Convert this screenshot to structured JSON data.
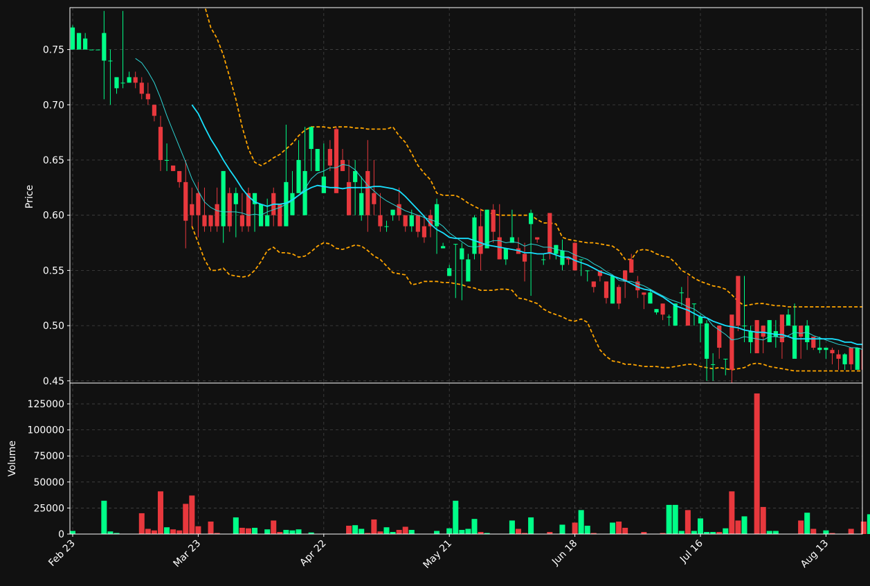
{
  "chart_data": {
    "type": "candlestick",
    "price_axis": {
      "label": "Price",
      "ylim": [
        0.448,
        0.788
      ],
      "ticks": [
        0.45,
        0.5,
        0.55,
        0.6,
        0.65,
        0.7,
        0.75
      ],
      "tick_labels": [
        "0.45",
        "0.50",
        "0.55",
        "0.60",
        "0.65",
        "0.70",
        "0.75"
      ]
    },
    "volume_axis": {
      "label": "Volume",
      "ylim": [
        0,
        145000
      ],
      "ticks": [
        0,
        25000,
        50000,
        75000,
        100000,
        125000
      ],
      "tick_labels": [
        "0",
        "25000",
        "50000",
        "75000",
        "100000",
        "125000"
      ]
    },
    "x_ticks": [
      {
        "label": "Feb 23",
        "index": 0
      },
      {
        "label": "Mar 23",
        "index": 20
      },
      {
        "label": "Apr 22",
        "index": 40
      },
      {
        "label": "May 21",
        "index": 60
      },
      {
        "label": "Jun 18",
        "index": 80
      },
      {
        "label": "Jul 16",
        "index": 100
      },
      {
        "label": "Aug 13",
        "index": 120
      }
    ],
    "grid": true,
    "colors": {
      "up": "#00ff88",
      "down": "#e8383d",
      "ma_fast": "#2dd4d4",
      "ma_slow": "#19e1ff",
      "bands": "#ffa500"
    },
    "candles": {
      "open": [
        0.75,
        0.75,
        0.75,
        0.75,
        0.75,
        0.74,
        0.74,
        0.715,
        0.72,
        0.72,
        0.725,
        0.72,
        0.71,
        0.7,
        0.68,
        0.65,
        0.645,
        0.64,
        0.63,
        0.61,
        0.62,
        0.6,
        0.6,
        0.61,
        0.59,
        0.62,
        0.61,
        0.6,
        0.62,
        0.61,
        0.59,
        0.59,
        0.62,
        0.61,
        0.59,
        0.6,
        0.62,
        0.6,
        0.66,
        0.64,
        0.62,
        0.66,
        0.678,
        0.65,
        0.63,
        0.63,
        0.6,
        0.64,
        0.62,
        0.6,
        0.59,
        0.6,
        0.61,
        0.6,
        0.59,
        0.6,
        0.59,
        0.6,
        0.59,
        0.57,
        0.545,
        0.574,
        0.56,
        0.54,
        0.565,
        0.59,
        0.57,
        0.605,
        0.58,
        0.56,
        0.575,
        0.57,
        0.565,
        0.592,
        0.58,
        0.56,
        0.602,
        0.565,
        0.555,
        0.562,
        0.575,
        0.56,
        0.55,
        0.54,
        0.55,
        0.54,
        0.52,
        0.535,
        0.55,
        0.56,
        0.54,
        0.53,
        0.52,
        0.512,
        0.52,
        0.508,
        0.5,
        0.53,
        0.525,
        0.52,
        0.502,
        0.47,
        0.465,
        0.5,
        0.47,
        0.51,
        0.545,
        0.5,
        0.485,
        0.505,
        0.5,
        0.485,
        0.49,
        0.51,
        0.5,
        0.47,
        0.5,
        0.485,
        0.49,
        0.478,
        0.478,
        0.478,
        0.474,
        0.465,
        0.48,
        0.46,
        0.478,
        0.478,
        0.488,
        0.462
      ],
      "close": [
        0.77,
        0.765,
        0.76,
        0.75,
        0.75,
        0.765,
        0.74,
        0.725,
        0.72,
        0.725,
        0.72,
        0.71,
        0.705,
        0.69,
        0.65,
        0.65,
        0.64,
        0.63,
        0.595,
        0.6,
        0.6,
        0.59,
        0.59,
        0.59,
        0.64,
        0.59,
        0.62,
        0.59,
        0.59,
        0.62,
        0.61,
        0.6,
        0.6,
        0.59,
        0.63,
        0.62,
        0.65,
        0.64,
        0.68,
        0.66,
        0.635,
        0.645,
        0.62,
        0.64,
        0.6,
        0.64,
        0.62,
        0.6,
        0.61,
        0.59,
        0.59,
        0.605,
        0.6,
        0.59,
        0.6,
        0.585,
        0.58,
        0.59,
        0.61,
        0.572,
        0.552,
        0.574,
        0.57,
        0.56,
        0.598,
        0.565,
        0.605,
        0.585,
        0.56,
        0.57,
        0.58,
        0.565,
        0.558,
        0.602,
        0.578,
        0.56,
        0.565,
        0.573,
        0.568,
        0.56,
        0.55,
        0.56,
        0.55,
        0.535,
        0.545,
        0.525,
        0.545,
        0.52,
        0.54,
        0.548,
        0.532,
        0.528,
        0.53,
        0.515,
        0.51,
        0.508,
        0.52,
        0.53,
        0.5,
        0.52,
        0.508,
        0.502,
        0.465,
        0.48,
        0.47,
        0.46,
        0.5,
        0.5,
        0.495,
        0.475,
        0.49,
        0.505,
        0.495,
        0.485,
        0.51,
        0.5,
        0.49,
        0.5,
        0.48,
        0.48,
        0.48,
        0.475,
        0.47,
        0.474,
        0.465,
        0.48,
        0.46,
        0.482,
        0.478,
        0.488,
        0.48
      ],
      "high": [
        0.772,
        0.765,
        0.765,
        0.75,
        0.75,
        0.785,
        0.75,
        0.725,
        0.785,
        0.73,
        0.73,
        0.725,
        0.72,
        0.7,
        0.69,
        0.665,
        0.645,
        0.64,
        0.65,
        0.625,
        0.63,
        0.625,
        0.6,
        0.625,
        0.64,
        0.625,
        0.625,
        0.62,
        0.625,
        0.62,
        0.61,
        0.615,
        0.625,
        0.61,
        0.682,
        0.64,
        0.668,
        0.68,
        0.675,
        0.66,
        0.665,
        0.668,
        0.68,
        0.66,
        0.65,
        0.65,
        0.635,
        0.668,
        0.65,
        0.62,
        0.595,
        0.605,
        0.625,
        0.6,
        0.605,
        0.6,
        0.6,
        0.605,
        0.615,
        0.575,
        0.555,
        0.574,
        0.575,
        0.565,
        0.6,
        0.606,
        0.605,
        0.61,
        0.61,
        0.57,
        0.605,
        0.58,
        0.575,
        0.605,
        0.58,
        0.565,
        0.602,
        0.573,
        0.578,
        0.562,
        0.575,
        0.56,
        0.55,
        0.54,
        0.55,
        0.54,
        0.545,
        0.537,
        0.55,
        0.565,
        0.545,
        0.53,
        0.533,
        0.515,
        0.52,
        0.51,
        0.52,
        0.535,
        0.545,
        0.52,
        0.51,
        0.505,
        0.475,
        0.48,
        0.47,
        0.47,
        0.51,
        0.545,
        0.5,
        0.505,
        0.49,
        0.505,
        0.505,
        0.49,
        0.515,
        0.52,
        0.5,
        0.505,
        0.49,
        0.49,
        0.48,
        0.48,
        0.478,
        0.475,
        0.478,
        0.48,
        0.465,
        0.485,
        0.49,
        0.49,
        0.488
      ],
      "low": [
        0.75,
        0.75,
        0.75,
        0.75,
        0.75,
        0.705,
        0.7,
        0.71,
        0.715,
        0.72,
        0.715,
        0.705,
        0.7,
        0.685,
        0.64,
        0.64,
        0.64,
        0.625,
        0.57,
        0.59,
        0.58,
        0.585,
        0.585,
        0.585,
        0.575,
        0.585,
        0.58,
        0.585,
        0.585,
        0.585,
        0.595,
        0.595,
        0.59,
        0.59,
        0.59,
        0.61,
        0.62,
        0.62,
        0.64,
        0.64,
        0.63,
        0.64,
        0.62,
        0.64,
        0.6,
        0.6,
        0.595,
        0.585,
        0.6,
        0.585,
        0.585,
        0.595,
        0.595,
        0.585,
        0.585,
        0.58,
        0.575,
        0.58,
        0.565,
        0.57,
        0.545,
        0.525,
        0.523,
        0.545,
        0.56,
        0.55,
        0.57,
        0.575,
        0.56,
        0.555,
        0.575,
        0.565,
        0.54,
        0.527,
        0.575,
        0.555,
        0.56,
        0.56,
        0.55,
        0.555,
        0.55,
        0.545,
        0.54,
        0.53,
        0.54,
        0.52,
        0.52,
        0.515,
        0.525,
        0.548,
        0.525,
        0.515,
        0.52,
        0.51,
        0.505,
        0.5,
        0.5,
        0.518,
        0.5,
        0.5,
        0.485,
        0.45,
        0.45,
        0.47,
        0.455,
        0.448,
        0.495,
        0.485,
        0.475,
        0.495,
        0.475,
        0.5,
        0.48,
        0.47,
        0.5,
        0.49,
        0.47,
        0.478,
        0.478,
        0.475,
        0.47,
        0.465,
        0.46,
        0.46,
        0.46,
        0.47,
        0.46,
        0.478,
        0.475,
        0.468,
        0.462
      ]
    },
    "volume": [
      3000,
      0,
      0,
      0,
      0,
      32000,
      2500,
      1000,
      0,
      0,
      0,
      20000,
      5000,
      3500,
      41000,
      6500,
      4500,
      3500,
      29000,
      37000,
      7500,
      0,
      12000,
      1000,
      0,
      0,
      16000,
      6000,
      5500,
      6000,
      0,
      4500,
      13000,
      2000,
      4000,
      3500,
      4500,
      0,
      1500,
      0,
      0,
      0,
      0,
      0,
      8000,
      8500,
      5000,
      1000,
      14000,
      2500,
      6500,
      2000,
      4000,
      7000,
      4000,
      0,
      0,
      0,
      3000,
      0,
      5500,
      32000,
      4000,
      5000,
      14500,
      2000,
      1000,
      0,
      0,
      0,
      13000,
      5000,
      1000,
      16000,
      0,
      0,
      2000,
      0,
      9000,
      0,
      11000,
      23000,
      8000,
      1000,
      0,
      0,
      11000,
      12000,
      6000,
      0,
      0,
      2000,
      0,
      0,
      1000,
      28000,
      28000,
      3000,
      23000,
      3000,
      15000,
      2000,
      2000,
      2000,
      5500,
      41000,
      13000,
      17000,
      0,
      135000,
      26000,
      3000,
      3000,
      0,
      0,
      0,
      13000,
      20500,
      5000,
      0,
      3500,
      1000,
      0,
      0,
      5000,
      0,
      12000,
      19000,
      8000,
      7000,
      6000,
      4000,
      0,
      1000
    ],
    "ma_fast": [
      null,
      null,
      null,
      null,
      null,
      null,
      null,
      null,
      null,
      null,
      0.742,
      0.738,
      0.73,
      0.72,
      0.706,
      0.69,
      0.676,
      0.662,
      0.648,
      0.633,
      0.622,
      0.612,
      0.607,
      0.604,
      0.603,
      0.603,
      0.603,
      0.602,
      0.6,
      0.601,
      0.6,
      0.603,
      0.605,
      0.607,
      0.61,
      0.613,
      0.618,
      0.624,
      0.633,
      0.638,
      0.64,
      0.643,
      0.643,
      0.646,
      0.645,
      0.641,
      0.634,
      0.627,
      0.622,
      0.617,
      0.613,
      0.61,
      0.607,
      0.604,
      0.602,
      0.6,
      0.598,
      0.596,
      0.594,
      0.59,
      0.584,
      0.58,
      0.576,
      0.572,
      0.571,
      0.572,
      0.575,
      0.577,
      0.577,
      0.575,
      0.576,
      0.575,
      0.572,
      0.574,
      0.573,
      0.571,
      0.571,
      0.569,
      0.568,
      0.567,
      0.564,
      0.562,
      0.56,
      0.556,
      0.553,
      0.549,
      0.546,
      0.541,
      0.54,
      0.54,
      0.538,
      0.536,
      0.533,
      0.53,
      0.527,
      0.524,
      0.522,
      0.52,
      0.517,
      0.515,
      0.511,
      0.507,
      0.5,
      0.496,
      0.492,
      0.487,
      0.488,
      0.49,
      0.489,
      0.488,
      0.487,
      0.49,
      0.49,
      0.489,
      0.491,
      0.494,
      0.493,
      0.494,
      0.491,
      0.489,
      0.487,
      0.485,
      0.483,
      0.482,
      0.48,
      0.48,
      0.478,
      0.478,
      0.478,
      0.479,
      0.48
    ],
    "ma_slow": [
      null,
      null,
      null,
      null,
      null,
      null,
      null,
      null,
      null,
      null,
      null,
      null,
      null,
      null,
      null,
      null,
      null,
      null,
      null,
      0.7,
      0.692,
      0.68,
      0.669,
      0.66,
      0.65,
      0.641,
      0.633,
      0.624,
      0.617,
      0.612,
      0.61,
      0.608,
      0.61,
      0.61,
      0.611,
      0.614,
      0.618,
      0.622,
      0.625,
      0.627,
      0.626,
      0.625,
      0.625,
      0.624,
      0.625,
      0.625,
      0.625,
      0.625,
      0.626,
      0.626,
      0.625,
      0.624,
      0.622,
      0.617,
      0.611,
      0.605,
      0.599,
      0.592,
      0.587,
      0.584,
      0.58,
      0.579,
      0.579,
      0.579,
      0.577,
      0.575,
      0.573,
      0.572,
      0.571,
      0.57,
      0.569,
      0.568,
      0.566,
      0.566,
      0.565,
      0.565,
      0.566,
      0.564,
      0.562,
      0.562,
      0.559,
      0.557,
      0.555,
      0.552,
      0.549,
      0.547,
      0.545,
      0.543,
      0.541,
      0.538,
      0.535,
      0.533,
      0.532,
      0.529,
      0.526,
      0.522,
      0.518,
      0.516,
      0.514,
      0.511,
      0.508,
      0.507,
      0.504,
      0.502,
      0.5,
      0.499,
      0.498,
      0.496,
      0.495,
      0.494,
      0.494,
      0.493,
      0.492,
      0.492,
      0.49,
      0.488,
      0.488,
      0.488,
      0.488,
      0.488,
      0.488,
      0.488,
      0.487,
      0.485,
      0.485,
      0.483,
      0.483
    ],
    "band_upper": [
      null,
      null,
      null,
      null,
      null,
      null,
      null,
      null,
      null,
      null,
      null,
      null,
      null,
      null,
      null,
      null,
      null,
      null,
      null,
      0.82,
      0.805,
      0.79,
      0.77,
      0.76,
      0.745,
      0.725,
      0.705,
      0.68,
      0.66,
      0.648,
      0.645,
      0.648,
      0.652,
      0.655,
      0.66,
      0.665,
      0.672,
      0.677,
      0.68,
      0.68,
      0.68,
      0.679,
      0.68,
      0.68,
      0.68,
      0.679,
      0.679,
      0.678,
      0.678,
      0.678,
      0.678,
      0.68,
      0.672,
      0.666,
      0.656,
      0.645,
      0.638,
      0.632,
      0.62,
      0.618,
      0.618,
      0.618,
      0.615,
      0.611,
      0.608,
      0.605,
      0.603,
      0.601,
      0.6,
      0.6,
      0.6,
      0.6,
      0.6,
      0.6,
      0.596,
      0.593,
      0.593,
      0.592,
      0.58,
      0.578,
      0.577,
      0.576,
      0.575,
      0.575,
      0.574,
      0.573,
      0.572,
      0.568,
      0.56,
      0.56,
      0.568,
      0.569,
      0.568,
      0.565,
      0.563,
      0.562,
      0.557,
      0.55,
      0.547,
      0.543,
      0.54,
      0.538,
      0.536,
      0.535,
      0.533,
      0.528,
      0.522,
      0.518,
      0.519,
      0.52,
      0.52,
      0.519,
      0.518,
      0.518,
      0.517,
      0.517,
      0.517,
      0.517,
      0.517,
      0.517,
      0.517,
      0.517,
      0.517,
      0.517,
      0.517,
      0.517,
      0.517
    ],
    "band_lower": [
      null,
      null,
      null,
      null,
      null,
      null,
      null,
      null,
      null,
      null,
      null,
      null,
      null,
      null,
      null,
      null,
      null,
      null,
      null,
      0.59,
      0.575,
      0.56,
      0.55,
      0.55,
      0.552,
      0.546,
      0.545,
      0.544,
      0.545,
      0.55,
      0.558,
      0.568,
      0.571,
      0.566,
      0.566,
      0.565,
      0.562,
      0.563,
      0.567,
      0.572,
      0.575,
      0.574,
      0.57,
      0.569,
      0.571,
      0.573,
      0.572,
      0.568,
      0.563,
      0.56,
      0.554,
      0.548,
      0.547,
      0.546,
      0.537,
      0.538,
      0.54,
      0.54,
      0.54,
      0.539,
      0.539,
      0.538,
      0.537,
      0.535,
      0.534,
      0.532,
      0.532,
      0.532,
      0.533,
      0.533,
      0.532,
      0.525,
      0.524,
      0.522,
      0.52,
      0.515,
      0.512,
      0.51,
      0.508,
      0.505,
      0.504,
      0.506,
      0.503,
      0.49,
      0.478,
      0.472,
      0.468,
      0.467,
      0.465,
      0.465,
      0.464,
      0.463,
      0.463,
      0.463,
      0.462,
      0.462,
      0.463,
      0.464,
      0.465,
      0.465,
      0.463,
      0.462,
      0.461,
      0.462,
      0.461,
      0.46,
      0.461,
      0.462,
      0.465,
      0.466,
      0.465,
      0.463,
      0.462,
      0.461,
      0.46,
      0.459,
      0.459,
      0.459,
      0.459,
      0.459,
      0.459,
      0.459,
      0.459,
      0.459,
      0.459,
      0.459,
      0.459
    ]
  }
}
